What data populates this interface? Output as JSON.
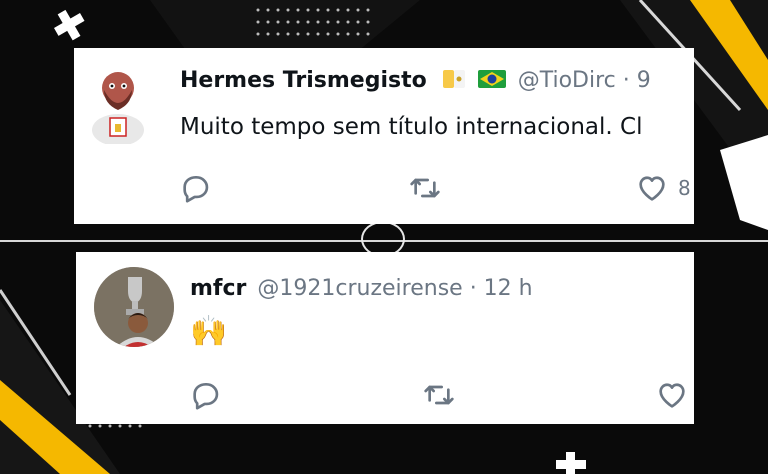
{
  "theme": {
    "accent_yellow": "#ffb400",
    "background": "#0a0a0a",
    "card_background": "#ffffff",
    "text_primary": "#0f1419",
    "text_secondary": "#6b7683"
  },
  "tweets": [
    {
      "display_name": "Hermes Trismegisto",
      "badges": [
        "vatican-flag-icon",
        "brazil-flag-icon"
      ],
      "handle": "@TioDirc · 9",
      "text": "Muito tempo sem título internacional. Cl",
      "actions": {
        "reply_icon": "reply-icon",
        "retweet_icon": "retweet-icon",
        "like_icon": "heart-icon",
        "like_count": "8"
      }
    },
    {
      "display_name": "mfcr",
      "handle": "@1921cruzeirense · 12 h",
      "text": "🙌",
      "actions": {
        "reply_icon": "reply-icon",
        "retweet_icon": "retweet-icon",
        "like_icon": "heart-icon"
      }
    }
  ]
}
